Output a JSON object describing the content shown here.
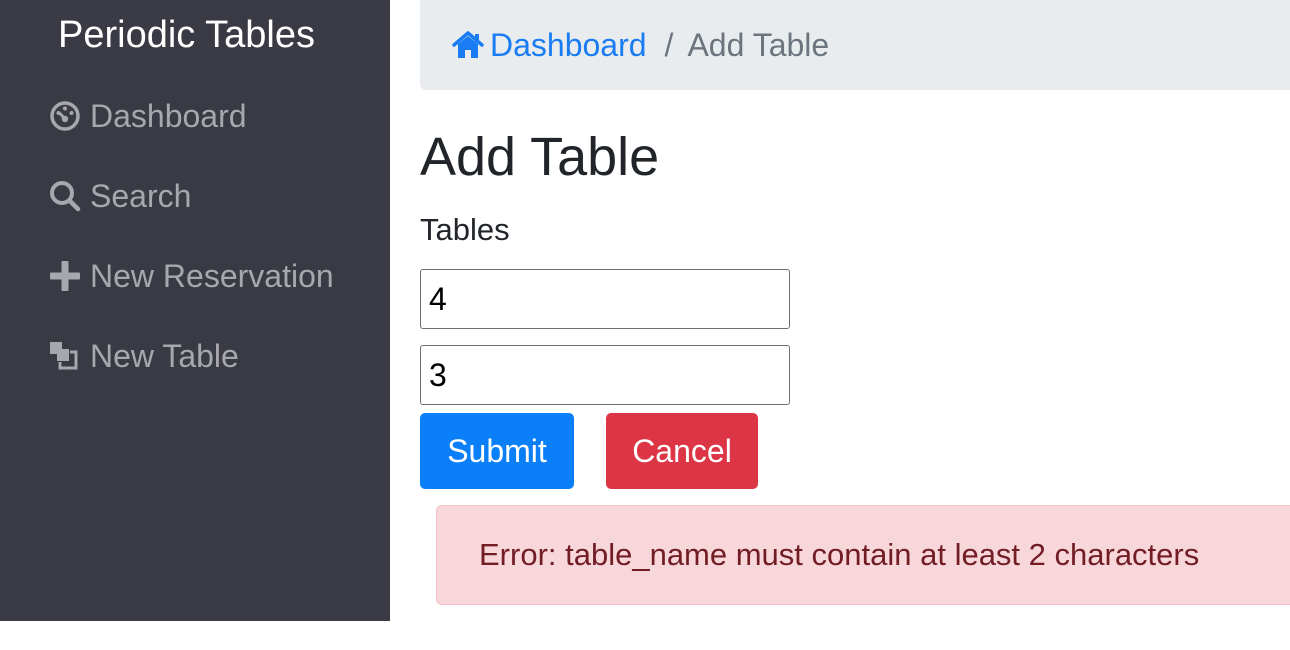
{
  "sidebar": {
    "brand": "Periodic Tables",
    "items": [
      {
        "label": "Dashboard",
        "icon": "dashboard-gauge-icon"
      },
      {
        "label": "Search",
        "icon": "search-icon"
      },
      {
        "label": "New Reservation",
        "icon": "plus-icon"
      },
      {
        "label": "New Table",
        "icon": "layers-icon"
      }
    ]
  },
  "breadcrumb": {
    "home_label": "Dashboard",
    "home_icon": "home-icon",
    "separator": "/",
    "current": "Add Table"
  },
  "main": {
    "title": "Add Table",
    "field_label": "Tables",
    "inputs": [
      {
        "value": "4"
      },
      {
        "value": "3"
      }
    ],
    "submit_label": "Submit",
    "cancel_label": "Cancel",
    "error_message": "Error: table_name must contain at least 2 characters"
  },
  "colors": {
    "sidebar_bg": "#3a3a44",
    "primary": "#0a7ff7",
    "danger": "#dc3545",
    "alert_bg": "#f8d7da",
    "alert_text": "#721c24"
  }
}
